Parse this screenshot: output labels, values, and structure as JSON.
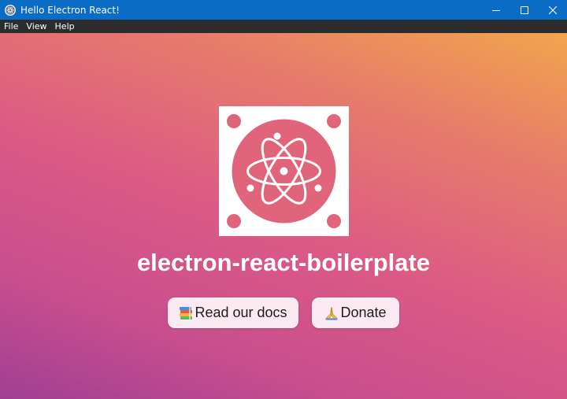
{
  "window": {
    "title": "Hello Electron React!"
  },
  "menu": {
    "items": [
      "File",
      "View",
      "Help"
    ]
  },
  "main": {
    "title": "electron-react-boilerplate",
    "buttons": {
      "docs_label": "Read our docs",
      "donate_label": "Donate"
    }
  },
  "icons": {
    "app": "electron-icon",
    "docs": "books-emoji-icon",
    "donate": "praying-hands-emoji-icon"
  },
  "colors": {
    "titlebar": "#0a6cc4",
    "menubar": "#2c2c2c",
    "logo_accent": "#e0647a",
    "button_bg": "#fbeaf1",
    "gradient": [
      "#f2a54c",
      "#e67b6b",
      "#dc5b84",
      "#c84e8e",
      "#a03f93"
    ]
  }
}
